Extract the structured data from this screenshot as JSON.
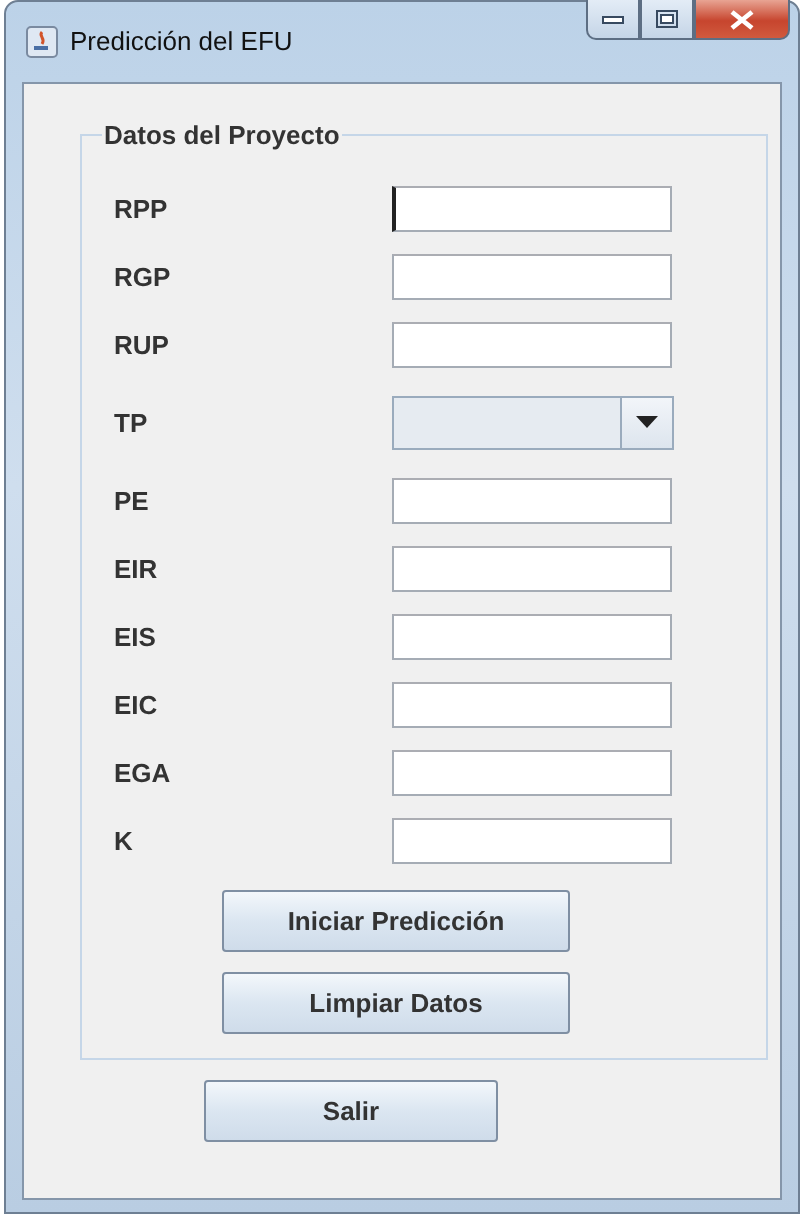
{
  "window": {
    "title": "Predicción del EFU"
  },
  "group": {
    "title": "Datos del Proyecto",
    "fields": [
      {
        "label": "RPP",
        "kind": "text",
        "focused": true
      },
      {
        "label": "RGP",
        "kind": "text",
        "focused": false
      },
      {
        "label": "RUP",
        "kind": "text",
        "focused": false
      },
      {
        "label": "TP",
        "kind": "combo",
        "focused": false
      },
      {
        "label": "PE",
        "kind": "text",
        "focused": false
      },
      {
        "label": "EIR",
        "kind": "text",
        "focused": false
      },
      {
        "label": "EIS",
        "kind": "text",
        "focused": false
      },
      {
        "label": "EIC",
        "kind": "text",
        "focused": false
      },
      {
        "label": "EGA",
        "kind": "text",
        "focused": false
      },
      {
        "label": "K",
        "kind": "text",
        "focused": false
      }
    ],
    "buttons": [
      "Iniciar Predicción",
      "Limpiar Datos"
    ]
  },
  "buttons": [
    "Salir"
  ]
}
